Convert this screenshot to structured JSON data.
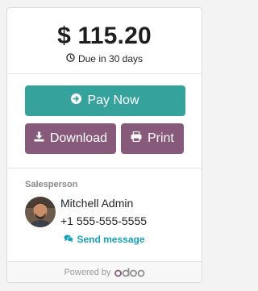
{
  "amount": {
    "value": "$ 115.20",
    "due_text": "Due in 30 days"
  },
  "actions": {
    "pay_label": "Pay Now",
    "download_label": "Download",
    "print_label": "Print"
  },
  "salesperson": {
    "heading": "Salesperson",
    "name": "Mitchell Admin",
    "phone": "+1 555-555-5555",
    "send_label": "Send message"
  },
  "footer": {
    "powered_by": "Powered by",
    "brand": "odoo"
  },
  "colors": {
    "pay": "#35a29b",
    "secondary": "#875a7b",
    "link": "#17a2b8",
    "odoo_purple": "#875a7b",
    "odoo_gray": "#8f8f8f"
  },
  "icons": {
    "due": "clock-icon",
    "pay": "arrow-circle-right-icon",
    "download": "download-icon",
    "print": "print-icon",
    "send": "comments-icon"
  }
}
